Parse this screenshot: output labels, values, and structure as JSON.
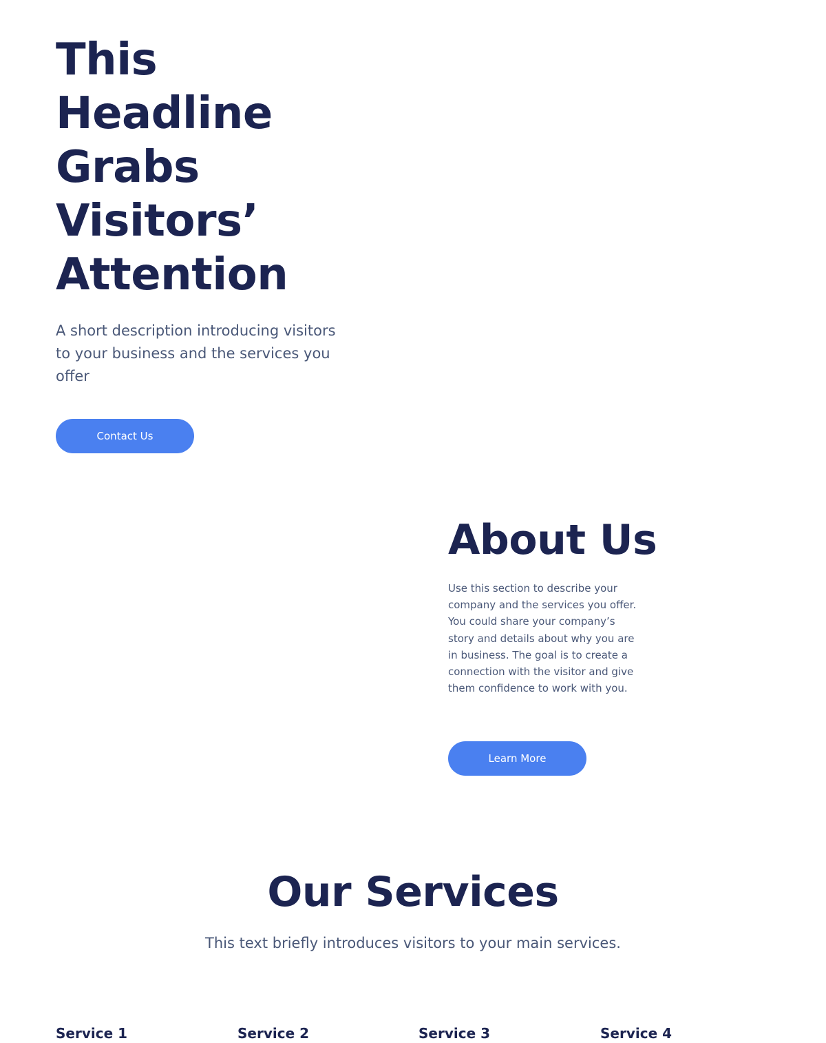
{
  "hero": {
    "title_lines": [
      "This",
      "Headline",
      "Grabs",
      "Visitors’",
      "Attention"
    ],
    "description": "A short description introducing visitors to your business and the services you offer",
    "cta_label": "Contact Us"
  },
  "about": {
    "title": "About Us",
    "text": "Use this section to describe your company and the services you offer. You could share your company’s story and details about why you are in business. The goal is to create a connection with the visitor and give them confidence to work with you.",
    "cta_label": "Learn More"
  },
  "services": {
    "title": "Our Services",
    "intro": "This text briefly introduces visitors to your main services.",
    "items": [
      {
        "label": "Service 1"
      },
      {
        "label": "Service 2"
      },
      {
        "label": "Service 3"
      },
      {
        "label": "Service 4"
      }
    ]
  },
  "colors": {
    "heading": "#1c2451",
    "body_text": "#4a5878",
    "accent": "#4a80f0",
    "background": "#ffffff"
  }
}
